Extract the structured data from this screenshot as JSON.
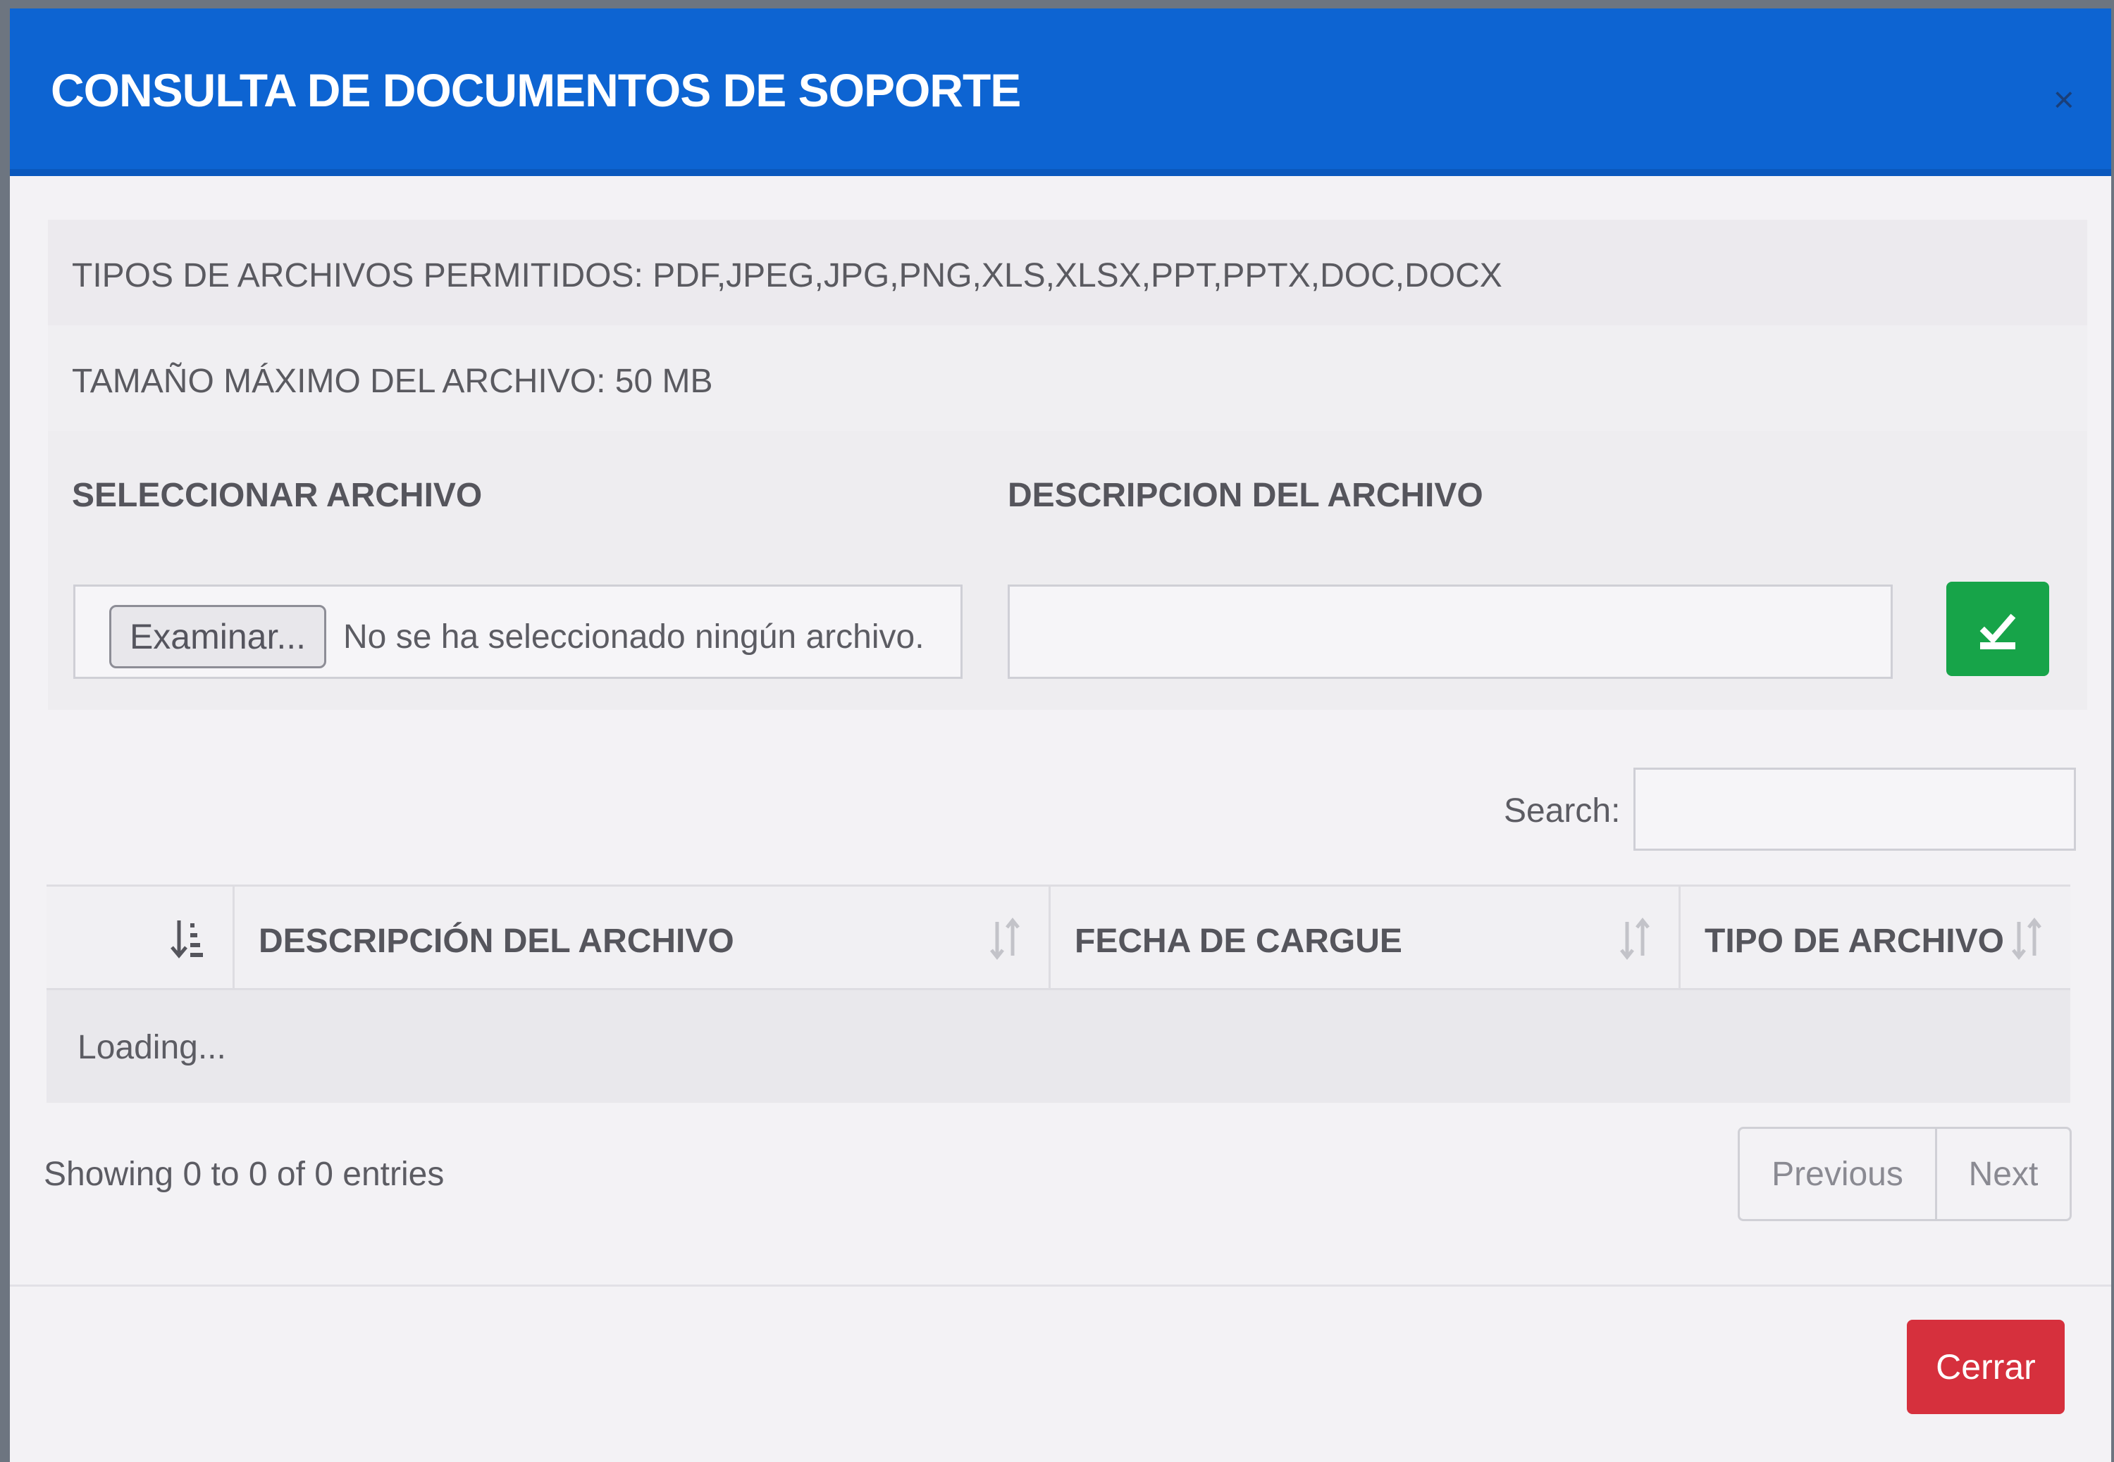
{
  "modal": {
    "title": "CONSULTA DE DOCUMENTOS DE SOPORTE",
    "close_symbol": "×"
  },
  "info": {
    "allowed_types": "TIPOS DE ARCHIVOS PERMITIDOS: PDF,JPEG,JPG,PNG,XLS,XLSX,PPT,PPTX,DOC,DOCX",
    "max_size": "TAMAÑO MÁXIMO DEL ARCHIVO: 50 MB"
  },
  "form": {
    "select_label": "SELECCIONAR ARCHIVO",
    "description_label": "DESCRIPCION DEL ARCHIVO",
    "browse_button": "Examinar...",
    "file_status": "No se ha seleccionado ningún archivo.",
    "description_value": "",
    "submit_icon": "upload-check-icon"
  },
  "search": {
    "label": "Search:",
    "value": ""
  },
  "table": {
    "columns": [
      "DESCRIPCIÓN DEL ARCHIVO",
      "FECHA DE CARGUE",
      "TIPO DE ARCHIVO"
    ],
    "loading_text": "Loading..."
  },
  "pagination": {
    "info": "Showing 0 to 0 of 0 entries",
    "previous": "Previous",
    "next": "Next"
  },
  "footer": {
    "close_button": "Cerrar"
  },
  "colors": {
    "header_blue": "#0d64d2",
    "success_green": "#17a449",
    "danger_red": "#d6303d"
  }
}
